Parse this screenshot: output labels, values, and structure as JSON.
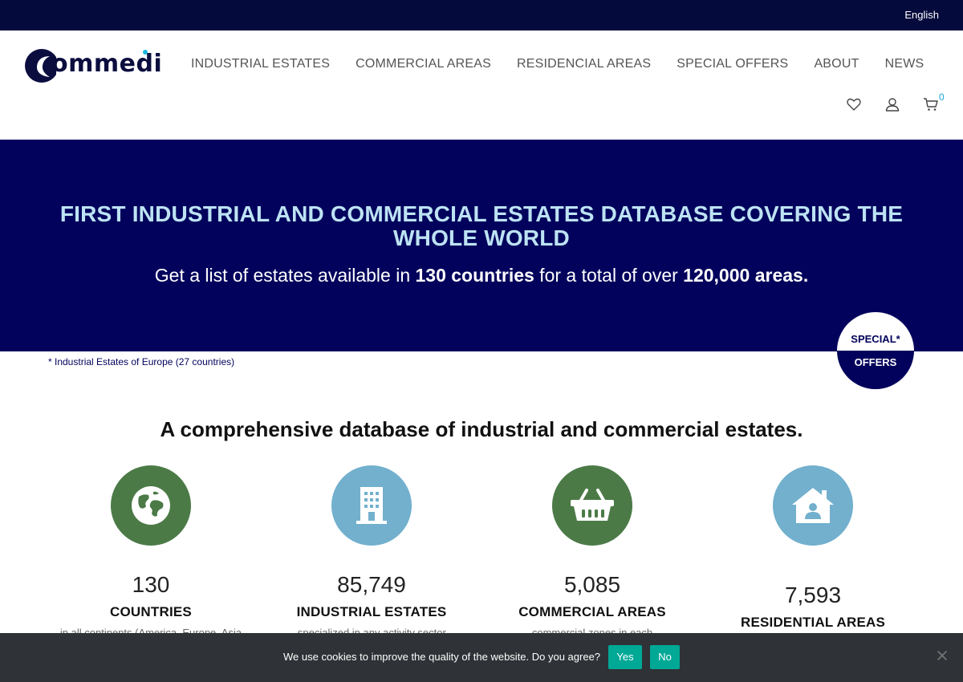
{
  "topbar": {
    "language": "English"
  },
  "logo": {
    "text": "ommedi"
  },
  "nav": {
    "items": [
      {
        "label": "INDUSTRIAL ESTATES"
      },
      {
        "label": "COMMERCIAL AREAS"
      },
      {
        "label": "RESIDENCIAL AREAS"
      },
      {
        "label": "SPECIAL OFFERS"
      },
      {
        "label": "ABOUT"
      },
      {
        "label": "NEWS"
      }
    ]
  },
  "header_icons": {
    "wishlist_icon": "heart-icon",
    "account_icon": "user-icon",
    "cart_icon": "cart-icon",
    "cart_count": "0"
  },
  "hero": {
    "title": "FIRST INDUSTRIAL AND COMMERCIAL ESTATES DATABASE COVERING THE WHOLE WORLD",
    "subtitle_part1": "Get a list of estates available in ",
    "subtitle_bold1": "130 countries",
    "subtitle_part2": " for a total of over ",
    "subtitle_bold2": "120,000 areas."
  },
  "special_badge": {
    "line1": "SPECIAL*",
    "line2": "OFFERS"
  },
  "note": "* Industrial Estates of Europe (27 countries)",
  "section": {
    "title": "A comprehensive database of industrial and commercial estates."
  },
  "stats": [
    {
      "number": "130",
      "label": "COUNTRIES",
      "icon": "globe-icon",
      "color": "#4b7a47",
      "desc": "...in all continents (America, Europe, Asia..."
    },
    {
      "number": "85,749",
      "label": "INDUSTRIAL ESTATES",
      "icon": "building-icon",
      "color": "#72b0cd",
      "desc": "...specialized in any activity sector..."
    },
    {
      "number": "5,085",
      "label": "COMMERCIAL AREAS",
      "icon": "basket-icon",
      "color": "#4b7a47",
      "desc": "...commercial zones in each..."
    },
    {
      "number": "7,593",
      "label": "RESIDENTIAL AREAS",
      "icon": "house-user-icon",
      "color": "#72b0cd",
      "desc": ""
    }
  ],
  "cookie": {
    "text": "We use cookies to improve the quality of the website. Do you agree?",
    "yes": "Yes",
    "no": "No"
  },
  "colors": {
    "topbar": "#050a3c",
    "hero_bg": "#02025c",
    "hero_title": "#bde3f3",
    "accent_blue": "#1ba6d6",
    "cookie_bg": "#2f3236",
    "cookie_button": "#00a896"
  }
}
